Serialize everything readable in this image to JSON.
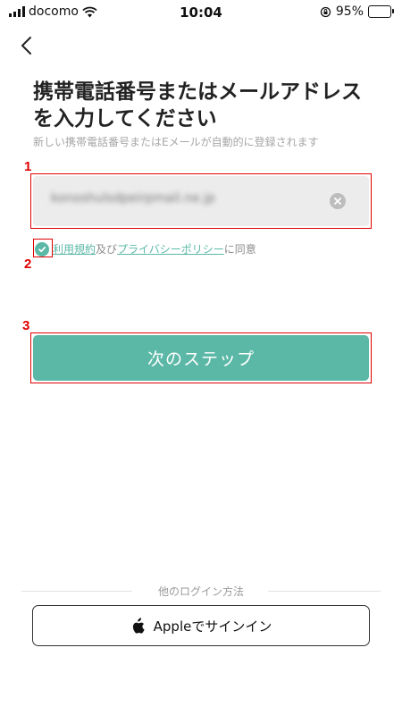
{
  "status_bar": {
    "carrier": "docomo",
    "time": "10:04",
    "battery_percent": "95%",
    "battery_level": 0.95
  },
  "header": {
    "back_icon": "chevron-left-icon"
  },
  "title": {
    "line1": "携帯電話番号またはメールアドレス",
    "line2": "を入力してください",
    "subtitle": "新しい携帯電話番号またはEメールが自動的に登録されます"
  },
  "markers": [
    "1",
    "2",
    "3"
  ],
  "email_field": {
    "value": "konoshulsdpeirpmail.ne.jp",
    "clear_icon": "clear-circle-icon"
  },
  "consent": {
    "checked": true,
    "terms_link": "利用規約",
    "conjunction": "及び",
    "privacy_link": "プライバシーポリシー",
    "suffix": "に同意"
  },
  "next_button": {
    "label": "次のステップ"
  },
  "other_login": {
    "divider_label": "他のログイン方法",
    "apple_button_label": "Appleでサインイン"
  },
  "colors": {
    "accent": "#5bb8a7",
    "marker": "#e00000",
    "field_bg": "#ececec"
  }
}
